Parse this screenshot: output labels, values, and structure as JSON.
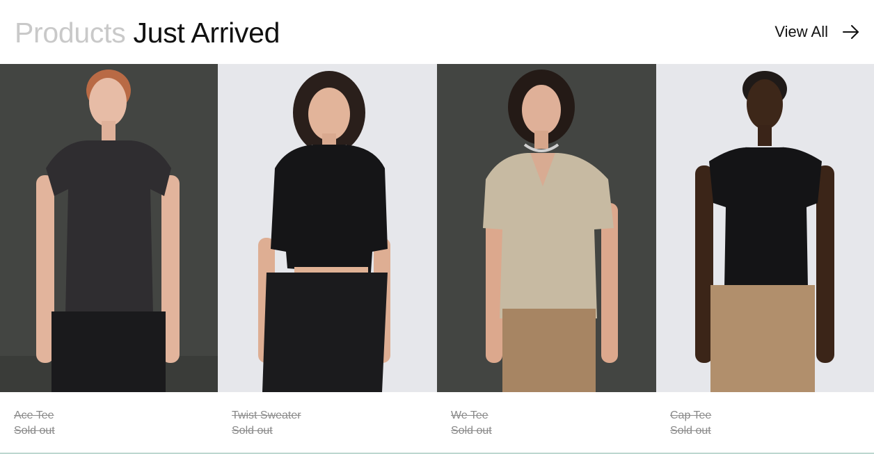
{
  "header": {
    "title_muted": "Products",
    "title_strong": "Just Arrived",
    "view_all_label": "View All",
    "view_all_icon": "arrow-right-icon"
  },
  "products": [
    {
      "name": "Ace Tee",
      "status": "Sold out",
      "image": "model in charcoal crew-neck tee and black jeans, dark backdrop"
    },
    {
      "name": "Twist Sweater",
      "status": "Sold out",
      "image": "model in black knit polo sweater and black jeans, light backdrop"
    },
    {
      "name": "We Tee",
      "status": "Sold out",
      "image": "model in beige v-neck tee and tan jeans, dark backdrop"
    },
    {
      "name": "Cap Tee",
      "status": "Sold out",
      "image": "model in black sleeveless tee and tan jeans, light backdrop"
    }
  ],
  "colors": {
    "muted_title": "#c9c9c9",
    "sold_out_text": "#8a8a8a",
    "dark_backdrop": "#434542",
    "light_backdrop": "#e6e7eb"
  }
}
